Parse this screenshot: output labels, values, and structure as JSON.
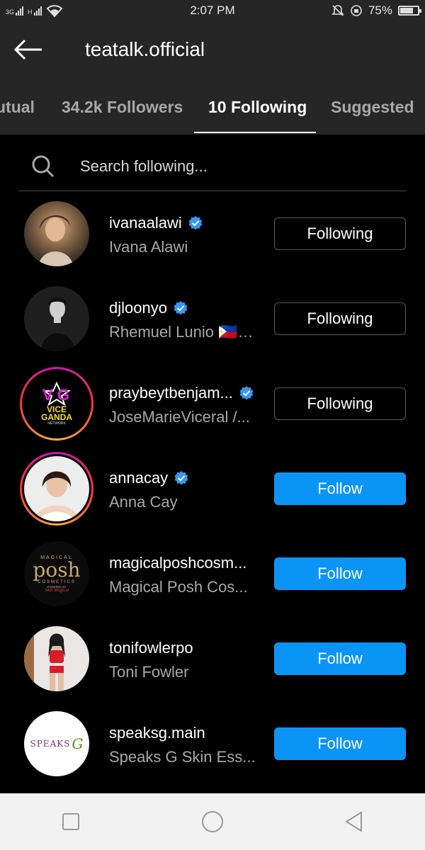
{
  "status_bar": {
    "network_labels": [
      "3G",
      "H"
    ],
    "time": "2:07 PM",
    "battery_percent": "75%",
    "battery_level": 0.75
  },
  "header": {
    "title": "teatalk.official",
    "back_icon": "arrow-left-icon"
  },
  "tabs": [
    {
      "label": "Mutual",
      "visible_text": "utual",
      "active": false
    },
    {
      "label": "34.2k Followers",
      "active": false
    },
    {
      "label": "10 Following",
      "active": true
    },
    {
      "label": "Suggested",
      "active": false
    }
  ],
  "search": {
    "placeholder": "Search following..."
  },
  "following_list": [
    {
      "username": "ivanaalawi",
      "full_name": "Ivana Alawi",
      "verified": true,
      "button": "Following",
      "story_ring": false
    },
    {
      "username": "djloonyo",
      "full_name": "Rhemuel Lunio 🇵🇭…",
      "verified": true,
      "button": "Following",
      "story_ring": false
    },
    {
      "username": "praybeytbenjam...",
      "full_name": "JoseMarieViceral /...",
      "verified": true,
      "button": "Following",
      "story_ring": true,
      "avatar_text": [
        "VICE",
        "GANDA",
        "NETWORK"
      ]
    },
    {
      "username": "annacay",
      "full_name": "Anna Cay",
      "verified": true,
      "button": "Follow",
      "story_ring": true
    },
    {
      "username": "magicalposhcosm...",
      "full_name": "Magical Posh Cos...",
      "verified": false,
      "button": "Follow",
      "story_ring": false,
      "avatar_text": [
        "MAGICAL",
        "posh",
        "COSMETICS",
        "POWERED BY",
        "Skin Magical"
      ]
    },
    {
      "username": "tonifowlerpo",
      "full_name": "Toni Fowler",
      "verified": false,
      "button": "Follow",
      "story_ring": false
    },
    {
      "username": "speaksg.main",
      "full_name": "Speaks G Skin Ess...",
      "verified": false,
      "button": "Follow",
      "story_ring": false,
      "avatar_text": [
        "SPEAKS",
        "G"
      ]
    }
  ],
  "nav_bar": {
    "buttons": [
      "recent-apps-icon",
      "home-icon",
      "back-triangle-icon"
    ]
  },
  "colors": {
    "background": "#000000",
    "header_bg": "#262626",
    "follow_button": "#0a95f6",
    "verified_badge": "#3897f0",
    "secondary_text": "#a8a8a8"
  }
}
